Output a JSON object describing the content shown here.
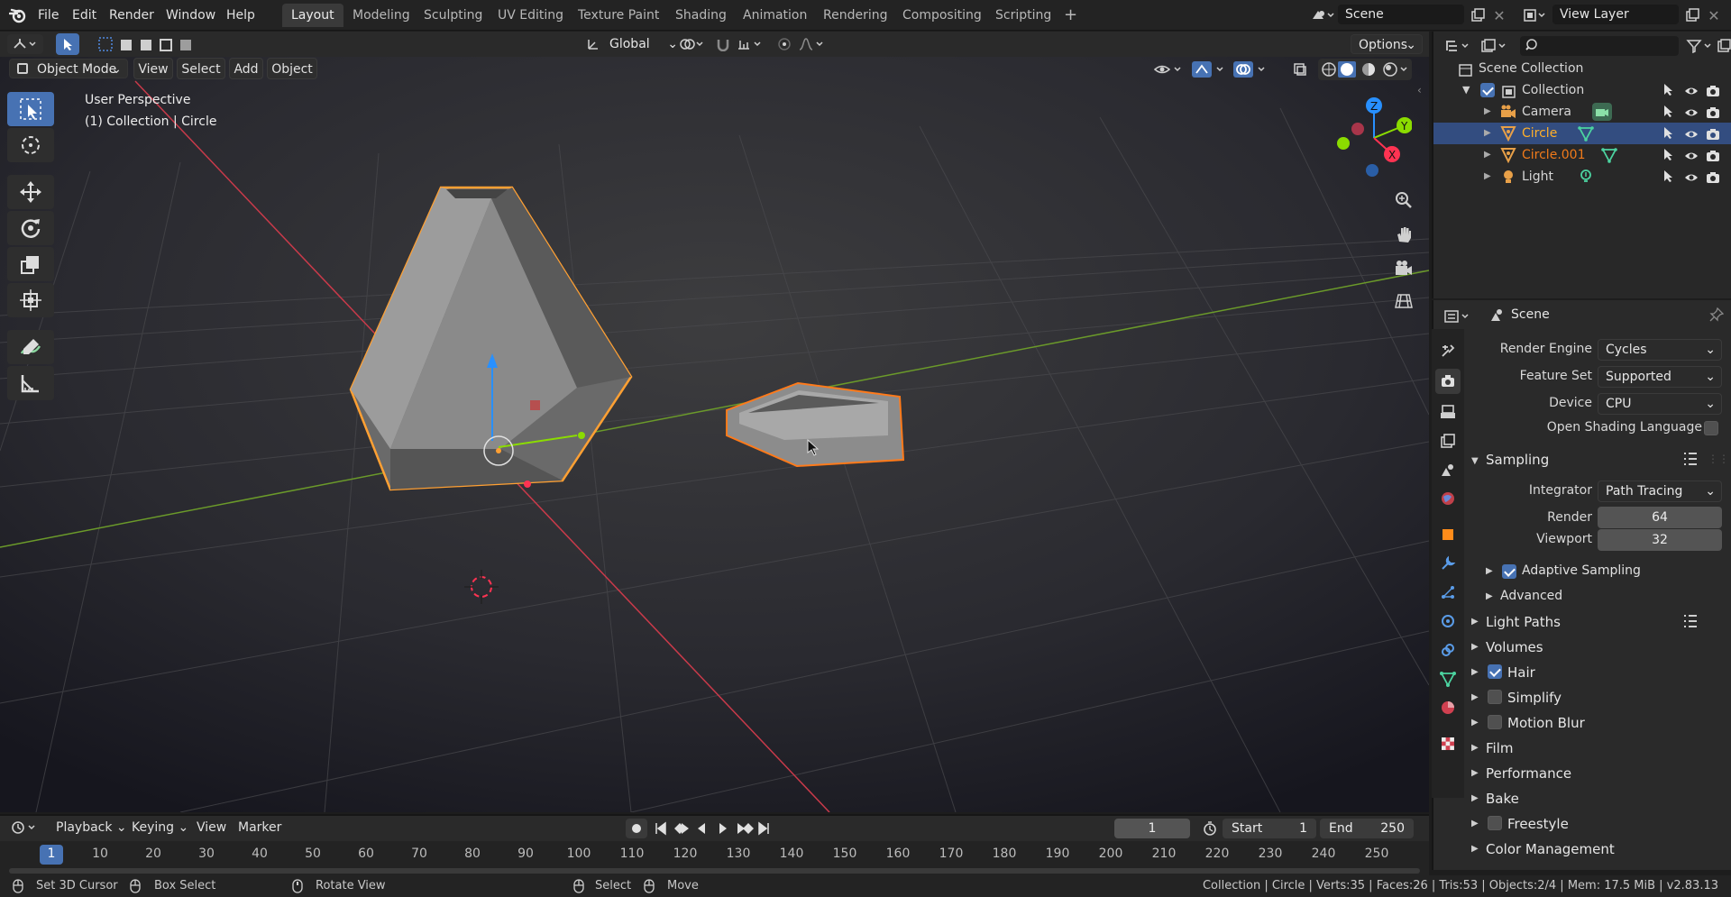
{
  "menu": [
    "File",
    "Edit",
    "Render",
    "Window",
    "Help"
  ],
  "workspaces": [
    "Layout",
    "Modeling",
    "Sculpting",
    "UV Editing",
    "Texture Paint",
    "Shading",
    "Animation",
    "Rendering",
    "Compositing",
    "Scripting"
  ],
  "scene_name": "Scene",
  "view_layer": "View Layer",
  "header": {
    "orientation": "Global",
    "options": "Options"
  },
  "viewport": {
    "mode": "Object Mode",
    "menus": [
      "View",
      "Select",
      "Add",
      "Object"
    ],
    "perspective": "User Perspective",
    "collection_label": "(1) Collection | Circle",
    "gizmo": {
      "x": "X",
      "y": "Y",
      "z": "Z"
    }
  },
  "outliner": {
    "search_placeholder": "",
    "root": "Scene Collection",
    "collection": "Collection",
    "items": [
      {
        "name": "Camera",
        "selected": false
      },
      {
        "name": "Circle",
        "selected": true
      },
      {
        "name": "Circle.001",
        "selected": false
      },
      {
        "name": "Light",
        "selected": false
      }
    ]
  },
  "properties": {
    "context": "Scene",
    "render_engine_label": "Render Engine",
    "render_engine": "Cycles",
    "feature_set_label": "Feature Set",
    "feature_set": "Supported",
    "device_label": "Device",
    "device": "CPU",
    "osl_label": "Open Shading Language",
    "sampling": "Sampling",
    "integrator_label": "Integrator",
    "integrator": "Path Tracing",
    "render_label": "Render",
    "render_samples": "64",
    "viewport_label": "Viewport",
    "viewport_samples": "32",
    "adaptive_sampling": "Adaptive Sampling",
    "advanced": "Advanced",
    "panels": [
      "Light Paths",
      "Volumes",
      "Hair",
      "Simplify",
      "Motion Blur",
      "Film",
      "Performance",
      "Bake",
      "Freestyle",
      "Color Management"
    ]
  },
  "timeline": {
    "menus": [
      "Playback",
      "Keying",
      "View",
      "Marker"
    ],
    "current_frame": "1",
    "start_label": "Start",
    "start": "1",
    "end_label": "End",
    "end": "250",
    "ticks": [
      "1",
      "10",
      "20",
      "30",
      "40",
      "50",
      "60",
      "70",
      "80",
      "90",
      "100",
      "110",
      "120",
      "130",
      "140",
      "150",
      "160",
      "170",
      "180",
      "190",
      "200",
      "210",
      "220",
      "230",
      "240",
      "250"
    ]
  },
  "status": {
    "set_cursor": "Set 3D Cursor",
    "box_select": "Box Select",
    "rotate_view": "Rotate View",
    "select": "Select",
    "move": "Move",
    "info": "Collection | Circle | Verts:35 | Faces:26 | Tris:53 | Objects:2/4 | Mem: 17.5 MiB | v2.83.13"
  },
  "colors": {
    "accent": "#4772b3",
    "selection_orange": "#ffa033",
    "x_axis": "#ff3352",
    "y_axis": "#8bdc00",
    "z_axis": "#2890ff"
  }
}
